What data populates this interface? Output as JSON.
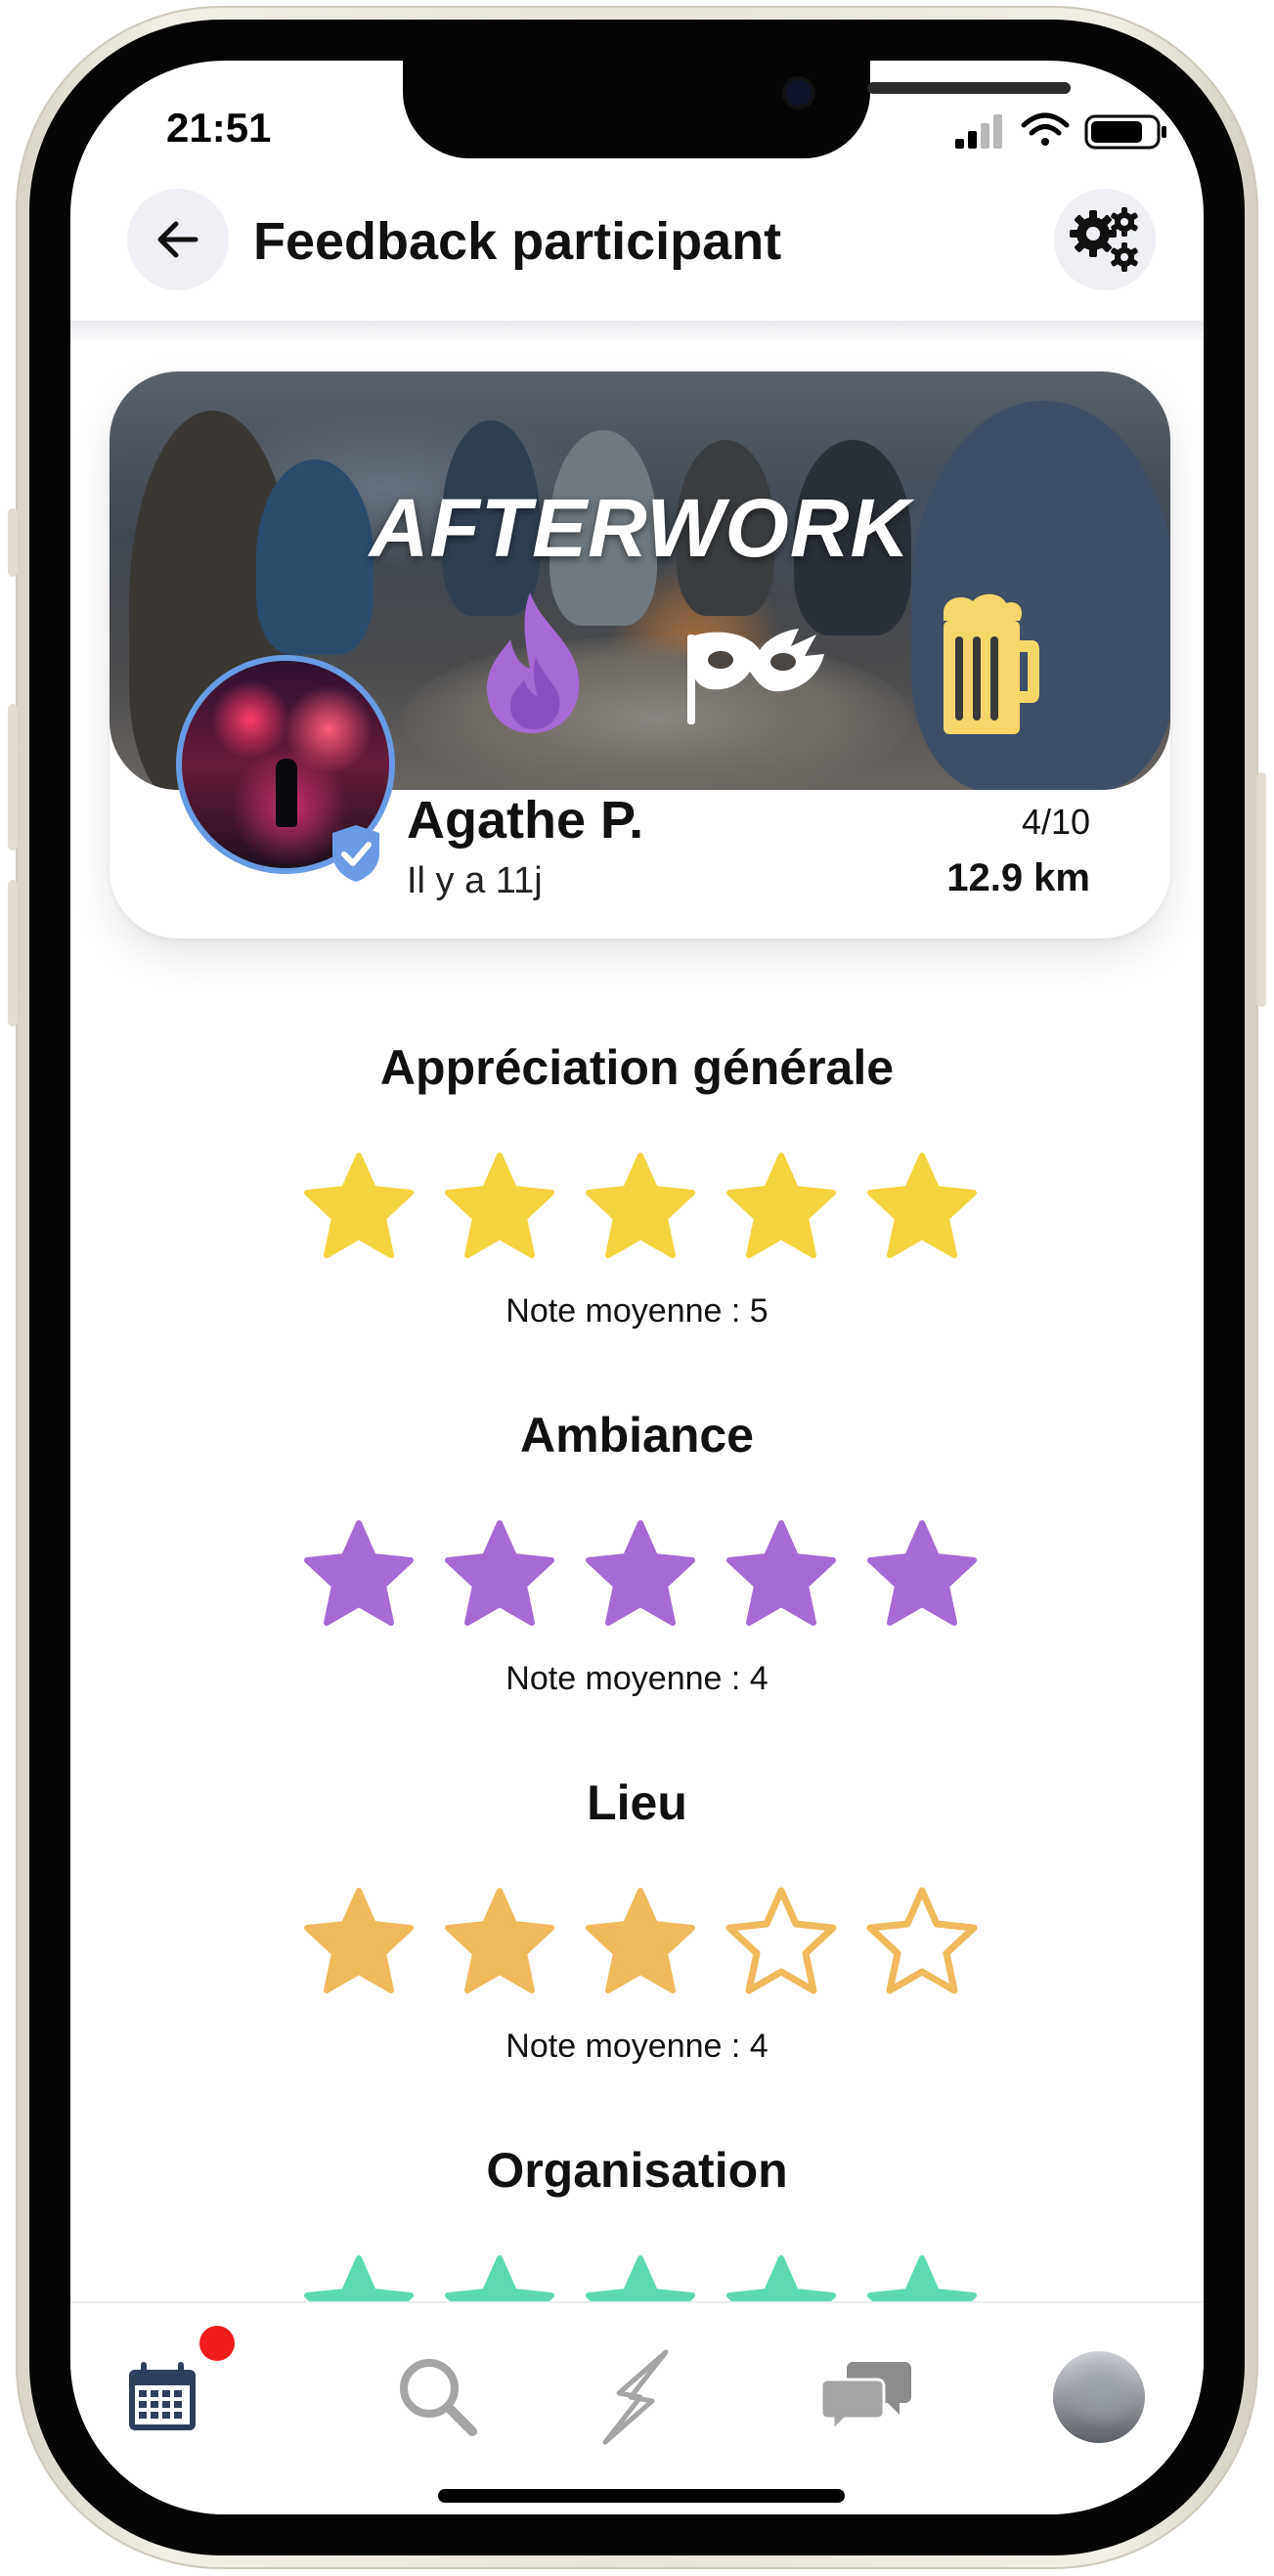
{
  "status_bar": {
    "time": "21:51"
  },
  "header": {
    "title": "Feedback participant",
    "back_icon": "arrow-left-icon",
    "settings_icon": "gears-icon"
  },
  "event": {
    "title": "AFTERWORK",
    "category_icons": [
      "flame-icon",
      "party-mask-icon",
      "beer-mug-icon"
    ],
    "host_name": "Agathe P.",
    "posted": "Il y a 11j",
    "participants": "4/10",
    "distance": "12.9 km",
    "verified": true
  },
  "ratings": [
    {
      "title": "Appréciation générale",
      "filled": 5,
      "total": 5,
      "color": "#F5D33F",
      "average_label": "Note moyenne : 5"
    },
    {
      "title": "Ambiance",
      "filled": 5,
      "total": 5,
      "color": "#A66AD4",
      "average_label": "Note moyenne : 4"
    },
    {
      "title": "Lieu",
      "filled": 3,
      "total": 5,
      "color": "#F0B95C",
      "average_label": "Note moyenne : 4"
    },
    {
      "title": "Organisation",
      "filled": 5,
      "total": 5,
      "color": "#5DD9B2",
      "average_label": ""
    }
  ],
  "nav": {
    "items": [
      "calendar-icon",
      "search-icon",
      "bolt-icon",
      "chat-icon",
      "profile-avatar"
    ],
    "calendar_has_notification": true
  },
  "colors": {
    "accent_blue": "#6A9BE4",
    "notification_red": "#F01C1C"
  }
}
